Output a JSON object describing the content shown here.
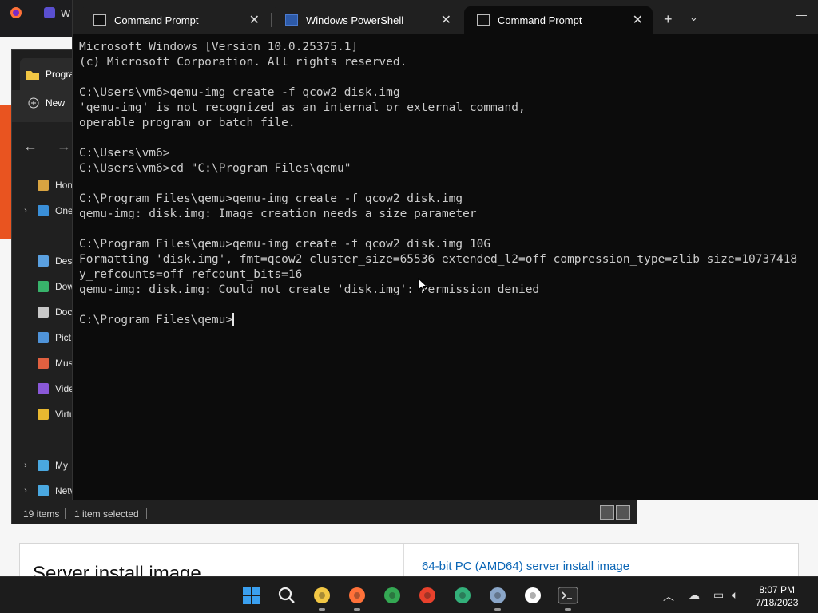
{
  "browser": {
    "tab_label": "W"
  },
  "explorer": {
    "tab_title": "Progra",
    "new_label": "New",
    "sidebar": [
      {
        "label": "Hon",
        "color": "#d9a441"
      },
      {
        "label": "One",
        "color": "#3a8fd8"
      },
      {
        "label": "Desl",
        "color": "#5aa0e0"
      },
      {
        "label": "Dow",
        "color": "#38b36b"
      },
      {
        "label": "Doc",
        "color": "#c8c8c8"
      },
      {
        "label": "Pict",
        "color": "#4f93d8"
      },
      {
        "label": "Mus",
        "color": "#e06040"
      },
      {
        "label": "Vide",
        "color": "#8a58d8"
      },
      {
        "label": "Virtu",
        "color": "#e8b830"
      },
      {
        "label": "My",
        "color": "#4aa8e0"
      },
      {
        "label": "Netv",
        "color": "#4aa8e0"
      }
    ],
    "status_items": "19 items",
    "status_selected": "1 item selected"
  },
  "webpage": {
    "card_title": "Server install image",
    "card_link": "64-bit PC (AMD64) server install image"
  },
  "terminal": {
    "tabs": [
      {
        "label": "Command Prompt",
        "kind": "cmd",
        "active": false
      },
      {
        "label": "Windows PowerShell",
        "kind": "ps",
        "active": false
      },
      {
        "label": "Command Prompt",
        "kind": "cmd",
        "active": true
      }
    ],
    "new_tab": "+",
    "dropdown": "⌄",
    "minimize": "—",
    "lines": [
      "Microsoft Windows [Version 10.0.25375.1]",
      "(c) Microsoft Corporation. All rights reserved.",
      "",
      "C:\\Users\\vm6>qemu-img create -f qcow2 disk.img",
      "'qemu-img' is not recognized as an internal or external command,",
      "operable program or batch file.",
      "",
      "C:\\Users\\vm6>",
      "C:\\Users\\vm6>cd \"C:\\Program Files\\qemu\"",
      "",
      "C:\\Program Files\\qemu>qemu-img create -f qcow2 disk.img",
      "qemu-img: disk.img: Image creation needs a size parameter",
      "",
      "C:\\Program Files\\qemu>qemu-img create -f qcow2 disk.img 10G",
      "Formatting 'disk.img', fmt=qcow2 cluster_size=65536 extended_l2=off compression_type=zlib size=10737418",
      "y_refcounts=off refcount_bits=16",
      "qemu-img: disk.img: Could not create 'disk.img': Permission denied",
      "",
      "C:\\Program Files\\qemu>"
    ]
  },
  "taskbar": {
    "apps": [
      {
        "name": "start-icon",
        "color": "#3aa0f0"
      },
      {
        "name": "search-icon",
        "color": "#eeeeee"
      },
      {
        "name": "file-explorer-icon",
        "color": "#f2c744"
      },
      {
        "name": "firefox-icon",
        "color": "#ff7139"
      },
      {
        "name": "chrome-icon",
        "color": "#34a853"
      },
      {
        "name": "maps-icon",
        "color": "#e8412c"
      },
      {
        "name": "edge-icon",
        "color": "#33b07a"
      },
      {
        "name": "settings-icon",
        "color": "#8aa6c8"
      },
      {
        "name": "solitaire-icon",
        "color": "#ffffff"
      },
      {
        "name": "terminal-icon",
        "color": "#3c3c3c"
      }
    ],
    "time": "8:07 PM",
    "date": "7/18/2023"
  }
}
